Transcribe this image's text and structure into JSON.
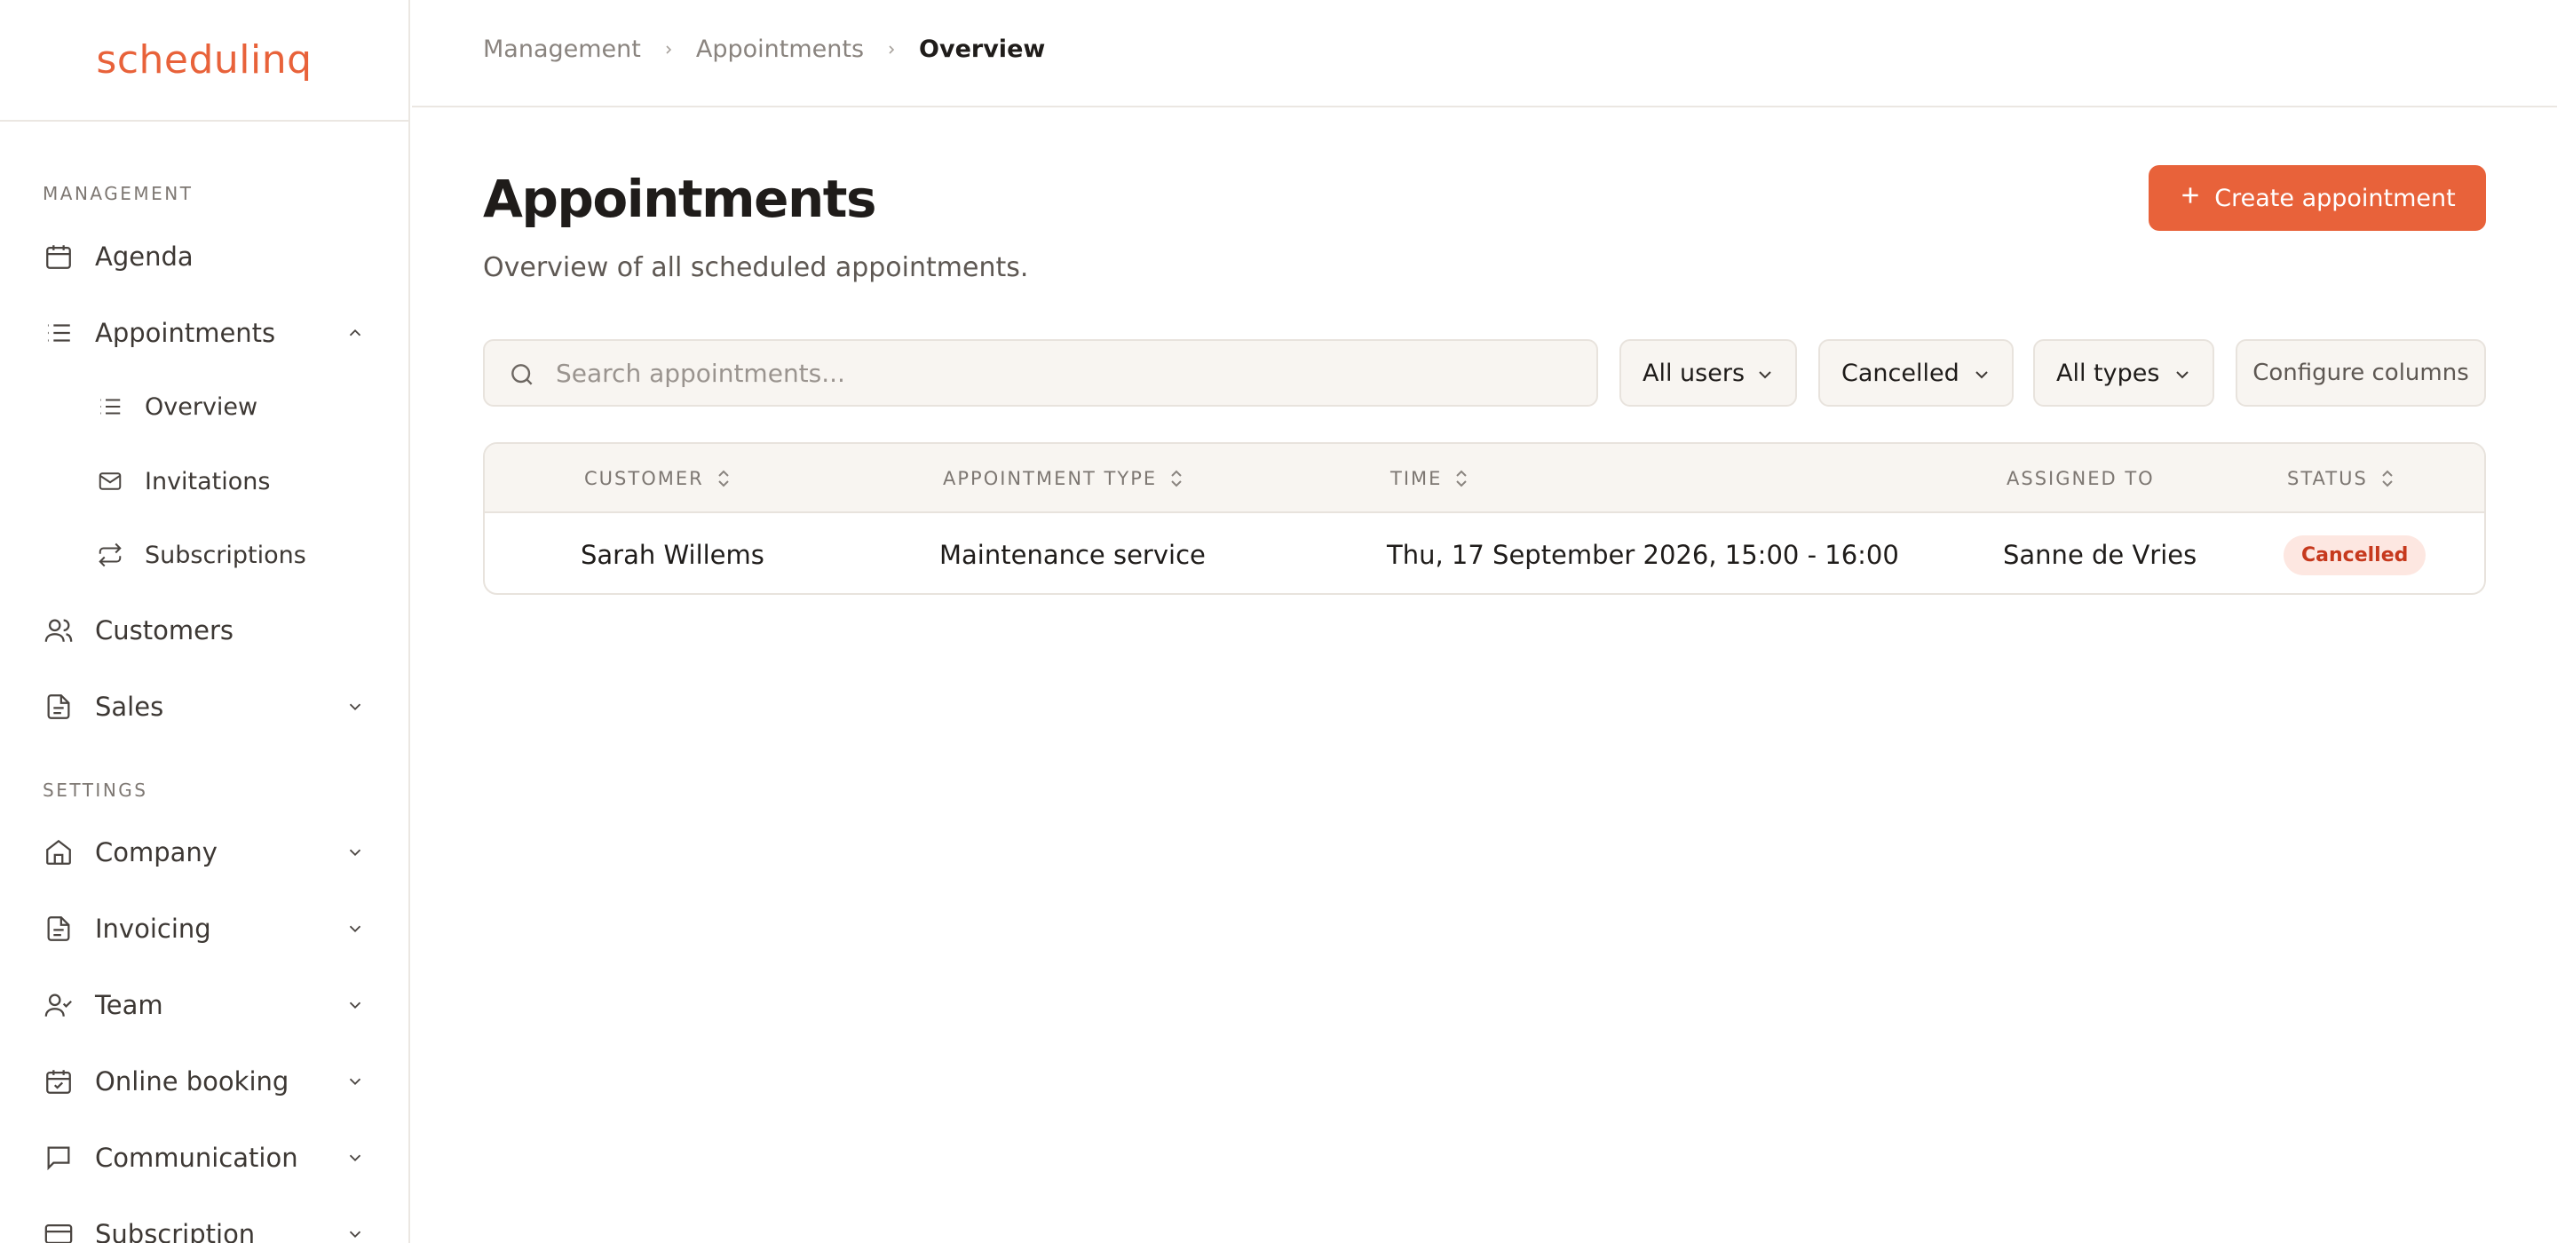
{
  "brand": {
    "logo_text": "schedulinq",
    "accent": "#e8623a"
  },
  "sidebar": {
    "sections": [
      {
        "label": "Management"
      },
      {
        "label": "Settings"
      }
    ],
    "items": [
      {
        "label": "Agenda",
        "icon": "calendar-icon"
      },
      {
        "label": "Appointments",
        "icon": "list-icon",
        "expanded": true
      },
      {
        "label": "Customers",
        "icon": "users-icon"
      },
      {
        "label": "Sales",
        "icon": "document-icon"
      },
      {
        "label": "Company",
        "icon": "home-icon"
      },
      {
        "label": "Invoicing",
        "icon": "document-icon"
      },
      {
        "label": "Team",
        "icon": "user-check-icon"
      },
      {
        "label": "Online booking",
        "icon": "calendar-check-icon"
      },
      {
        "label": "Communication",
        "icon": "message-icon"
      },
      {
        "label": "Subscription",
        "icon": "credit-card-icon"
      }
    ],
    "sub_items": [
      {
        "label": "Overview",
        "icon": "list-icon"
      },
      {
        "label": "Invitations",
        "icon": "mail-icon"
      },
      {
        "label": "Subscriptions",
        "icon": "repeat-icon"
      }
    ]
  },
  "breadcrumb": [
    "Management",
    "Appointments",
    "Overview"
  ],
  "header": {
    "title": "Appointments",
    "subtitle": "Overview of all scheduled appointments.",
    "create_label": "Create appointment"
  },
  "filters": {
    "search_placeholder": "Search appointments...",
    "users": "All users",
    "status": "Cancelled",
    "types": "All types",
    "configure": "Configure columns"
  },
  "table": {
    "columns": [
      "Customer",
      "Appointment type",
      "Time",
      "Assigned to",
      "Status"
    ],
    "rows": [
      {
        "customer": "Sarah Willems",
        "type": "Maintenance service",
        "time": "Thu, 17 September 2026, 15:00 - 16:00",
        "assigned": "Sanne de Vries",
        "status": "Cancelled"
      }
    ]
  }
}
